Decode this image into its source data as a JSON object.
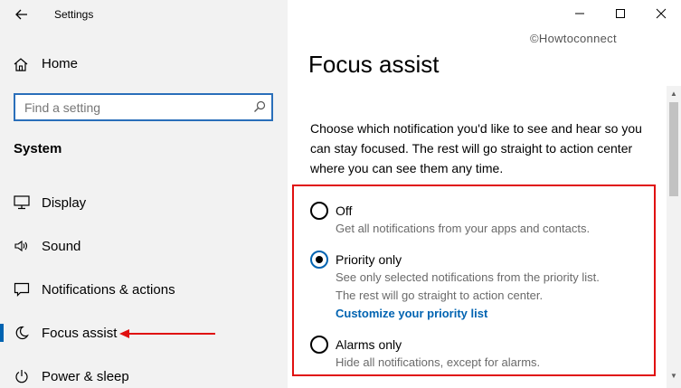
{
  "window": {
    "title": "Settings",
    "controls": {
      "minimize": "—",
      "maximize": "☐",
      "close": "✕"
    }
  },
  "watermark": "©Howtoconnect",
  "sidebar": {
    "home_label": "Home",
    "search": {
      "placeholder": "Find a setting"
    },
    "section_title": "System",
    "items": [
      {
        "label": "Display",
        "icon": "display-icon"
      },
      {
        "label": "Sound",
        "icon": "sound-icon"
      },
      {
        "label": "Notifications & actions",
        "icon": "notifications-icon"
      },
      {
        "label": "Focus assist",
        "icon": "moon-icon",
        "selected": true
      },
      {
        "label": "Power & sleep",
        "icon": "power-icon"
      }
    ]
  },
  "main": {
    "title": "Focus assist",
    "description": "Choose which notification you'd like to see and hear so you can stay focused. The rest will go straight to action center where you can see them any time.",
    "options": [
      {
        "label": "Off",
        "desc": "Get all notifications from your apps and contacts.",
        "checked": false
      },
      {
        "label": "Priority only",
        "desc1": "See only selected notifications from the priority list.",
        "desc2": "The rest will go straight to action center.",
        "link": "Customize your priority list",
        "checked": true
      },
      {
        "label": "Alarms only",
        "desc": "Hide all notifications, except for alarms.",
        "checked": false
      }
    ]
  },
  "colors": {
    "accent": "#0063b1",
    "highlight_border": "#e01010",
    "sidebar_bg": "#f2f2f2"
  }
}
